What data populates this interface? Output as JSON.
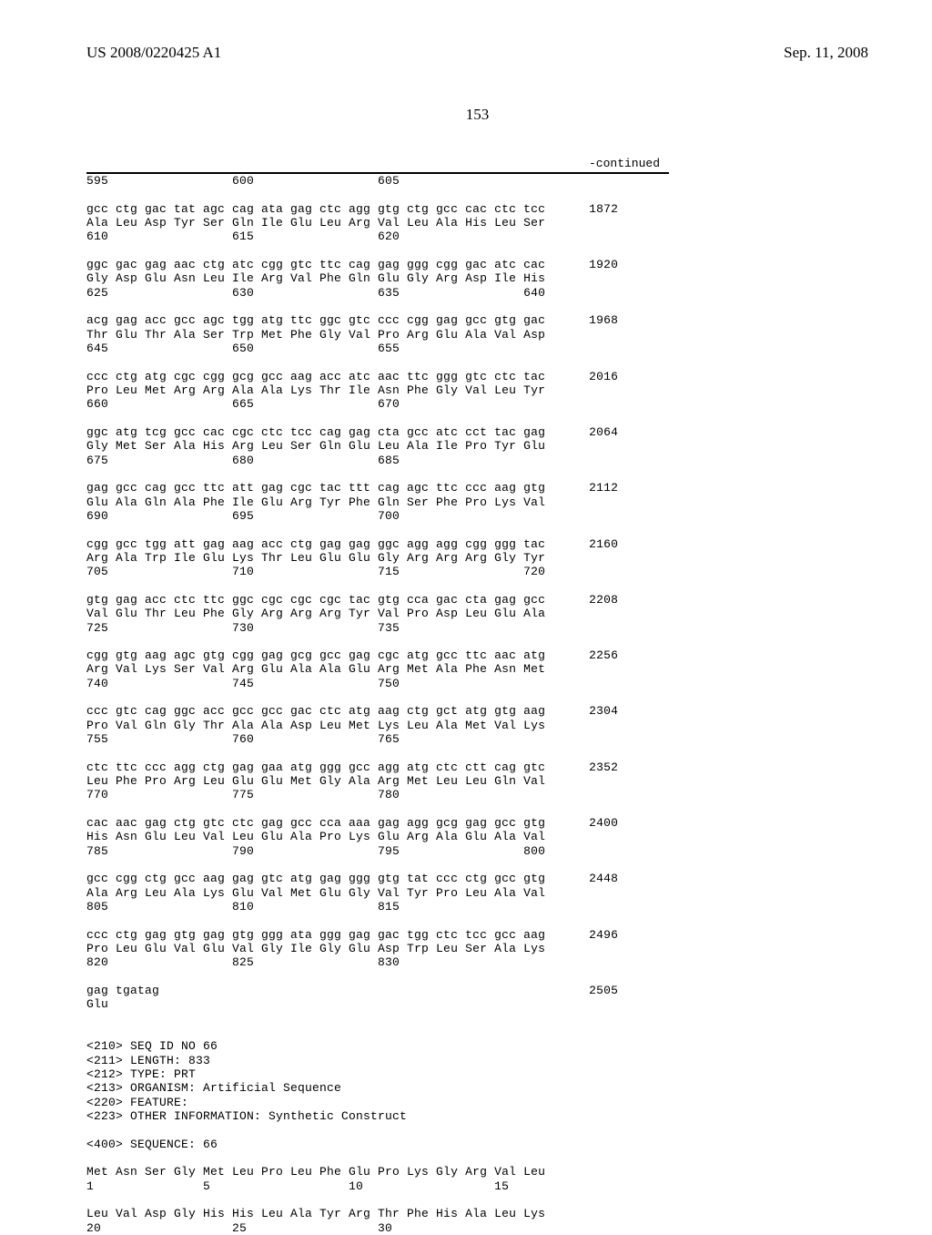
{
  "header": {
    "left": "US 2008/0220425 A1",
    "right": "Sep. 11, 2008"
  },
  "page_number": "153",
  "continued_label": "-continued",
  "sequence_text": "595                 600                 605\n\ngcc ctg gac tat agc cag ata gag ctc agg gtg ctg gcc cac ctc tcc      1872\nAla Leu Asp Tyr Ser Gln Ile Glu Leu Arg Val Leu Ala His Leu Ser\n610                 615                 620\n\nggc gac gag aac ctg atc cgg gtc ttc cag gag ggg cgg gac atc cac      1920\nGly Asp Glu Asn Leu Ile Arg Val Phe Gln Glu Gly Arg Asp Ile His\n625                 630                 635                 640\n\nacg gag acc gcc agc tgg atg ttc ggc gtc ccc cgg gag gcc gtg gac      1968\nThr Glu Thr Ala Ser Trp Met Phe Gly Val Pro Arg Glu Ala Val Asp\n645                 650                 655\n\nccc ctg atg cgc cgg gcg gcc aag acc atc aac ttc ggg gtc ctc tac      2016\nPro Leu Met Arg Arg Ala Ala Lys Thr Ile Asn Phe Gly Val Leu Tyr\n660                 665                 670\n\nggc atg tcg gcc cac cgc ctc tcc cag gag cta gcc atc cct tac gag      2064\nGly Met Ser Ala His Arg Leu Ser Gln Glu Leu Ala Ile Pro Tyr Glu\n675                 680                 685\n\ngag gcc cag gcc ttc att gag cgc tac ttt cag agc ttc ccc aag gtg      2112\nGlu Ala Gln Ala Phe Ile Glu Arg Tyr Phe Gln Ser Phe Pro Lys Val\n690                 695                 700\n\ncgg gcc tgg att gag aag acc ctg gag gag ggc agg agg cgg ggg tac      2160\nArg Ala Trp Ile Glu Lys Thr Leu Glu Glu Gly Arg Arg Arg Gly Tyr\n705                 710                 715                 720\n\ngtg gag acc ctc ttc ggc cgc cgc cgc tac gtg cca gac cta gag gcc      2208\nVal Glu Thr Leu Phe Gly Arg Arg Arg Tyr Val Pro Asp Leu Glu Ala\n725                 730                 735\n\ncgg gtg aag agc gtg cgg gag gcg gcc gag cgc atg gcc ttc aac atg      2256\nArg Val Lys Ser Val Arg Glu Ala Ala Glu Arg Met Ala Phe Asn Met\n740                 745                 750\n\nccc gtc cag ggc acc gcc gcc gac ctc atg aag ctg gct atg gtg aag      2304\nPro Val Gln Gly Thr Ala Ala Asp Leu Met Lys Leu Ala Met Val Lys\n755                 760                 765\n\nctc ttc ccc agg ctg gag gaa atg ggg gcc agg atg ctc ctt cag gtc      2352\nLeu Phe Pro Arg Leu Glu Glu Met Gly Ala Arg Met Leu Leu Gln Val\n770                 775                 780\n\ncac aac gag ctg gtc ctc gag gcc cca aaa gag agg gcg gag gcc gtg      2400\nHis Asn Glu Leu Val Leu Glu Ala Pro Lys Glu Arg Ala Glu Ala Val\n785                 790                 795                 800\n\ngcc cgg ctg gcc aag gag gtc atg gag ggg gtg tat ccc ctg gcc gtg      2448\nAla Arg Leu Ala Lys Glu Val Met Glu Gly Val Tyr Pro Leu Ala Val\n805                 810                 815\n\nccc ctg gag gtg gag gtg ggg ata ggg gag gac tgg ctc tcc gcc aag      2496\nPro Leu Glu Val Glu Val Gly Ile Gly Glu Asp Trp Leu Ser Ala Lys\n820                 825                 830\n\ngag tgatag                                                           2505\nGlu\n\n\n<210> SEQ ID NO 66\n<211> LENGTH: 833\n<212> TYPE: PRT\n<213> ORGANISM: Artificial Sequence\n<220> FEATURE:\n<223> OTHER INFORMATION: Synthetic Construct\n\n<400> SEQUENCE: 66\n\nMet Asn Ser Gly Met Leu Pro Leu Phe Glu Pro Lys Gly Arg Val Leu\n1               5                   10                  15\n\nLeu Val Asp Gly His His Leu Ala Tyr Arg Thr Phe His Ala Leu Lys\n20                  25                  30"
}
